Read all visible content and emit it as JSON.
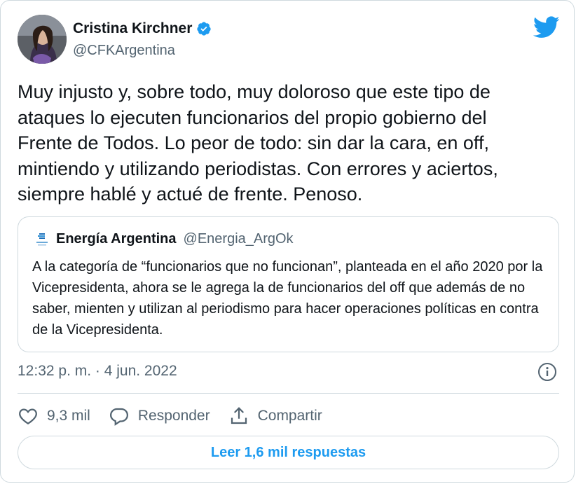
{
  "author": {
    "name": "Cristina Kirchner",
    "handle": "@CFKArgentina"
  },
  "tweet": {
    "text": "Muy injusto y, sobre todo, muy doloroso que este tipo de\nataques lo ejecuten funcionarios del propio gobierno del\nFrente de Todos. Lo peor de todo: sin dar la cara, en off,\nmintiendo y utilizando periodistas. Con errores y aciertos,\nsiempre hablé y actué de frente. Penoso.",
    "timestamp": "12:32 p. m. · 4 jun. 2022"
  },
  "quoted": {
    "name": "Energía Argentina",
    "handle": "@Energia_ArgOk",
    "text": "A la categoría de “funcionarios que no funcionan”, planteada en el año 2020 por la Vicepresidenta, ahora se le agrega la de funcionarios del off que además de no saber, mienten y utilizan al periodismo para hacer operaciones políticas en contra de la Vicepresidenta."
  },
  "actions": {
    "likes": "9,3 mil",
    "reply_label": "Responder",
    "share_label": "Compartir"
  },
  "replies_button": "Leer 1,6 mil respuestas",
  "colors": {
    "brand": "#1d9bf0",
    "text": "#0f1419",
    "secondary": "#536471",
    "border": "#cfd9de"
  },
  "icons": [
    "verified-badge-icon",
    "twitter-bird-icon",
    "info-icon",
    "heart-icon",
    "reply-icon",
    "share-icon"
  ]
}
